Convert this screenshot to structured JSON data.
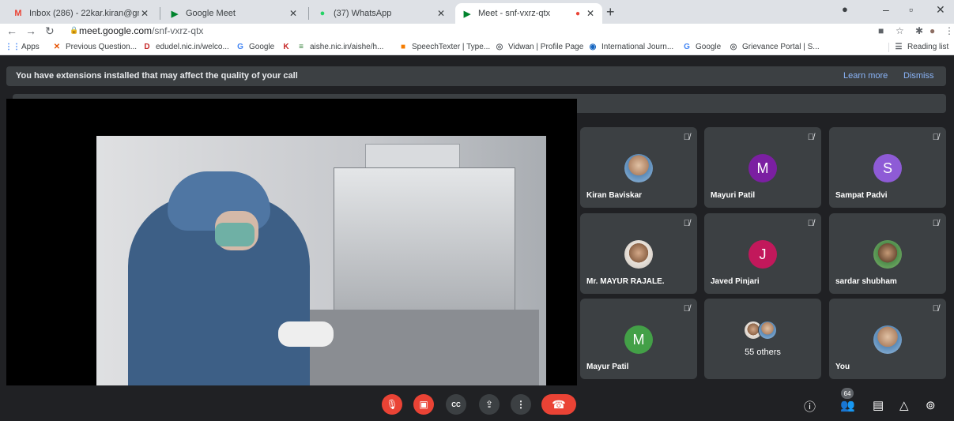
{
  "browser": {
    "tabs": [
      {
        "title": "Inbox (286) - 22kar.kiran@gmail.",
        "icon": "gmail-icon"
      },
      {
        "title": "Google Meet",
        "icon": "meet-icon"
      },
      {
        "title": "(37) WhatsApp",
        "icon": "whatsapp-icon"
      },
      {
        "title": "Meet - snf-vxrz-qtx",
        "icon": "meet-icon",
        "active": true
      }
    ],
    "url_host": "meet.google.com",
    "url_path": "/snf-vxrz-qtx",
    "bookmarks": [
      "Apps",
      "Previous Question...",
      "edudel.nic.in/welco...",
      "Google",
      "aishe.nic.in/aishe/h...",
      "SpeechTexter | Type...",
      "Vidwan | Profile Page",
      "International Journ...",
      "Google",
      "Grievance Portal | S..."
    ],
    "reading_list": "Reading list"
  },
  "meet": {
    "banner": {
      "message": "You have extensions installed that may affect the quality of your call",
      "learn_more": "Learn more",
      "dismiss": "Dismiss"
    },
    "participants": [
      {
        "name": "Kiran Baviskar",
        "type": "photo"
      },
      {
        "name": "Mayuri Patil",
        "type": "letter",
        "letter": "M",
        "color": "#7b1fa2"
      },
      {
        "name": "Sampat Padvi",
        "type": "letter",
        "letter": "S",
        "color": "#8e5bd6"
      },
      {
        "name": "Mr. MAYUR RAJALE.",
        "type": "photo"
      },
      {
        "name": "Javed Pinjari",
        "type": "letter",
        "letter": "J",
        "color": "#c2185b"
      },
      {
        "name": "sardar shubham",
        "type": "photo"
      },
      {
        "name": "Mayur Patil",
        "type": "letter",
        "letter": "M",
        "color": "#43a047"
      },
      {
        "name": "55 others",
        "type": "others"
      },
      {
        "name": "You",
        "type": "photo"
      }
    ],
    "participant_count": "64",
    "controls": {
      "captions_label": "CC",
      "more_label": "⋮"
    }
  }
}
